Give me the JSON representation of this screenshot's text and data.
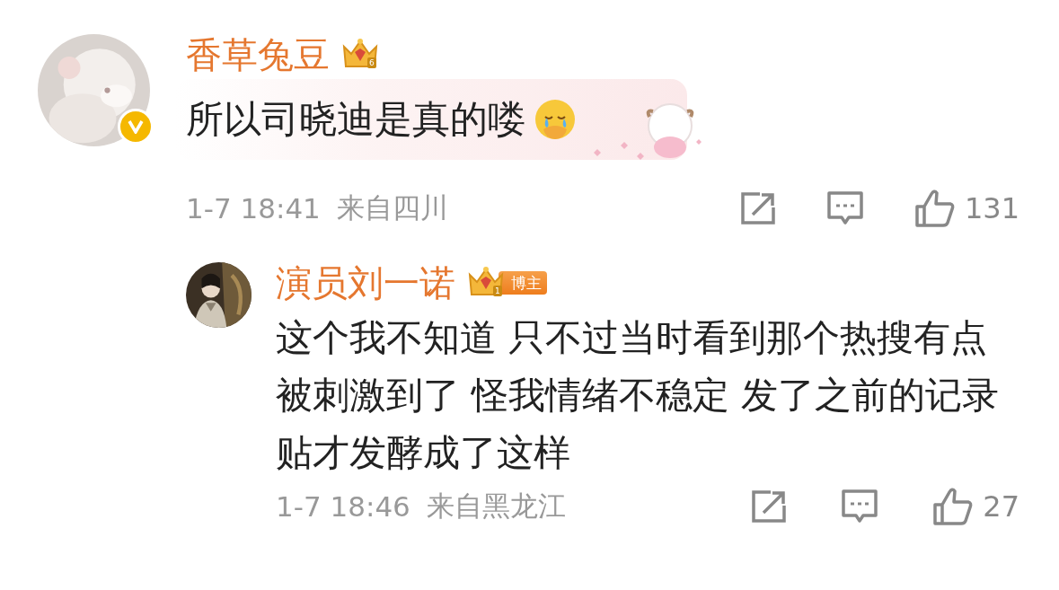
{
  "comments": [
    {
      "user_name": "香草兔豆",
      "level": "6",
      "verified": true,
      "text": "所以司晓迪是真的喽",
      "emoji": true,
      "sticker": true,
      "time": "1-7 18:41",
      "location": "来自四川",
      "likes": "131",
      "children": [
        {
          "user_name": "演员刘一诺",
          "level": "1",
          "role": "博主",
          "verified": false,
          "text": "这个我不知道 只不过当时看到那个热搜有点被刺激到了 怪我情绪不稳定 发了之前的记录贴才发酵成了这样",
          "time": "1-7 18:46",
          "location": "来自黑龙江",
          "likes": "27"
        }
      ]
    }
  ]
}
